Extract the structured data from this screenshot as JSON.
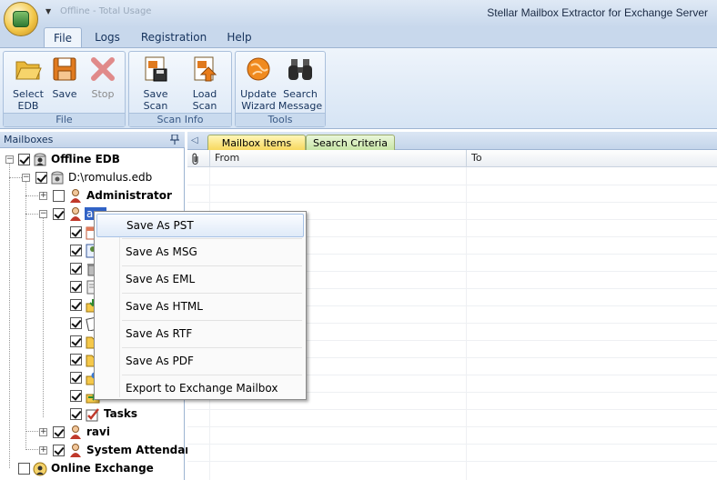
{
  "title_bar": {
    "app_title": "Stellar Mailbox Extractor for Exchange Server",
    "qat_ghost_text": "Offline - Total Usage"
  },
  "ribbon_tabs": [
    {
      "label": "File",
      "active": true
    },
    {
      "label": "Logs",
      "active": false
    },
    {
      "label": "Registration",
      "active": false
    },
    {
      "label": "Help",
      "active": false
    }
  ],
  "ribbon_groups": [
    {
      "label": "File",
      "buttons": [
        {
          "label": "Select EDB",
          "icon": "folder-open-icon",
          "enabled": true
        },
        {
          "label": "Save",
          "icon": "floppy-disk-icon",
          "enabled": true
        },
        {
          "label": "Stop",
          "icon": "red-x-icon",
          "enabled": false
        }
      ]
    },
    {
      "label": "Scan Info",
      "buttons": [
        {
          "label": "Save Scan Info",
          "icon": "save-scan-icon",
          "enabled": true
        },
        {
          "label": "Load Scan Info",
          "icon": "load-scan-icon",
          "enabled": true
        }
      ]
    },
    {
      "label": "Tools",
      "buttons": [
        {
          "label": "Update Wizard",
          "icon": "globe-update-icon",
          "enabled": true
        },
        {
          "label": "Search Message",
          "icon": "binoculars-icon",
          "enabled": true
        }
      ]
    }
  ],
  "mailboxes_panel": {
    "title": "Mailboxes",
    "tree": {
      "offline_edb": "Offline EDB",
      "edb_path": "D:\\romulus.edb",
      "administrator": "Administrator",
      "selected_user": "a",
      "tasks": "Tasks",
      "ravi": "ravi",
      "system_attendant": "System Attendant",
      "online_exchange": "Online Exchange"
    }
  },
  "content_tabs": [
    {
      "label": "Mailbox Items",
      "active": true
    },
    {
      "label": "Search Criteria",
      "active": false
    }
  ],
  "grid": {
    "columns": [
      "",
      "From",
      "To"
    ],
    "attachment_icon": "paperclip-icon"
  },
  "context_menu": {
    "items": [
      {
        "label": "Save As PST",
        "highlighted": true
      },
      {
        "label": "Save As MSG",
        "highlighted": false
      },
      {
        "label": "Save As EML",
        "highlighted": false
      },
      {
        "label": "Save As HTML",
        "highlighted": false
      },
      {
        "label": "Save As RTF",
        "highlighted": false
      },
      {
        "label": "Save As PDF",
        "highlighted": false
      },
      {
        "label": "Export to Exchange Mailbox",
        "highlighted": false
      }
    ]
  }
}
